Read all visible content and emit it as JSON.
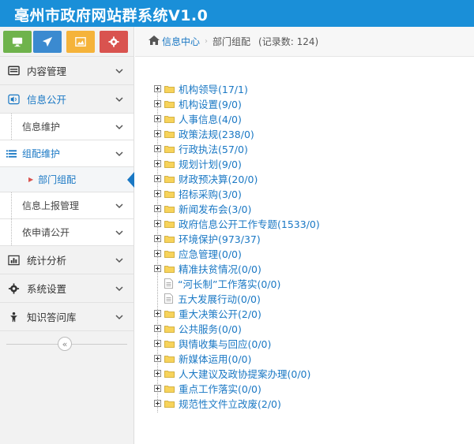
{
  "header": {
    "title": "亳州市政府网站群系统V1.0"
  },
  "shortcuts": [
    {
      "icon": "monitor-icon",
      "color": "#6fb34c"
    },
    {
      "icon": "send-icon",
      "color": "#3b8ad0"
    },
    {
      "icon": "picture-icon",
      "color": "#f5b33a"
    },
    {
      "icon": "settings-icon",
      "color": "#d9534f"
    }
  ],
  "sidebar": {
    "content_mgmt": "内容管理",
    "info_public": "信息公开",
    "info_maintain": "信息维护",
    "config_maintain": "组配维护",
    "dept_config": "部门组配",
    "info_report": "信息上报管理",
    "apply_public": "依申请公开",
    "stats": "统计分析",
    "system_settings": "系统设置",
    "knowledge": "知识答问库"
  },
  "breadcrumb": {
    "home": "信息中心",
    "current": "部门组配",
    "count": "(记录数: 124)"
  },
  "tree": [
    {
      "label": "机构领导(17/1)",
      "type": "folder"
    },
    {
      "label": "机构设置(9/0)",
      "type": "folder"
    },
    {
      "label": "人事信息(4/0)",
      "type": "folder"
    },
    {
      "label": "政策法规(238/0)",
      "type": "folder"
    },
    {
      "label": "行政执法(57/0)",
      "type": "folder"
    },
    {
      "label": "规划计划(9/0)",
      "type": "folder"
    },
    {
      "label": "财政预决算(20/0)",
      "type": "folder"
    },
    {
      "label": "招标采购(3/0)",
      "type": "folder"
    },
    {
      "label": "新闻发布会(3/0)",
      "type": "folder"
    },
    {
      "label": "政府信息公开工作专题(1533/0)",
      "type": "folder"
    },
    {
      "label": "环境保护(973/37)",
      "type": "folder"
    },
    {
      "label": "应急管理(0/0)",
      "type": "folder"
    },
    {
      "label": "精准扶贫情况(0/0)",
      "type": "folder"
    },
    {
      "label": "“河长制”工作落实(0/0)",
      "type": "doc"
    },
    {
      "label": "五大发展行动(0/0)",
      "type": "doc"
    },
    {
      "label": "重大决策公开(2/0)",
      "type": "folder"
    },
    {
      "label": "公共服务(0/0)",
      "type": "folder"
    },
    {
      "label": "舆情收集与回应(0/0)",
      "type": "folder"
    },
    {
      "label": "新媒体运用(0/0)",
      "type": "folder"
    },
    {
      "label": "人大建议及政协提案办理(0/0)",
      "type": "folder"
    },
    {
      "label": "重点工作落实(0/0)",
      "type": "folder"
    },
    {
      "label": "规范性文件立改废(2/0)",
      "type": "folder"
    }
  ]
}
